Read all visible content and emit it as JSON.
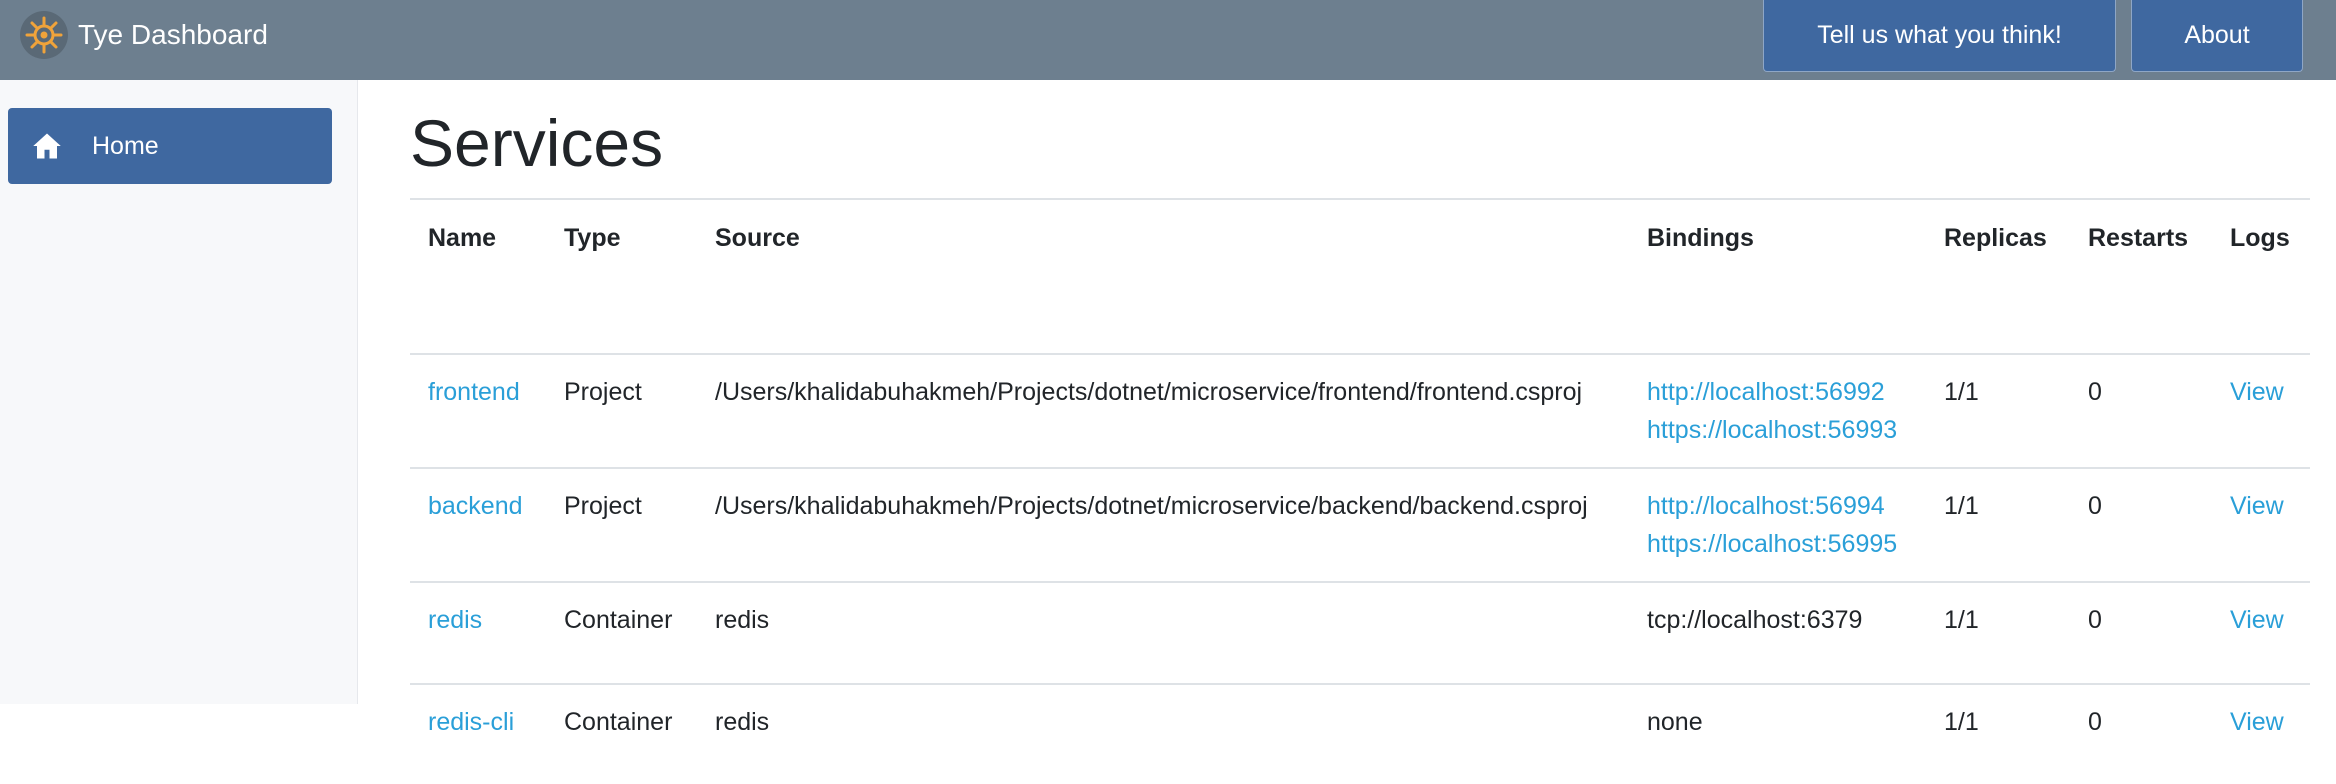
{
  "header": {
    "title": "Tye Dashboard",
    "feedback_label": "Tell us what you think!",
    "about_label": "About",
    "logo_icon": "ship-wheel-icon"
  },
  "sidebar": {
    "items": [
      {
        "label": "Home",
        "icon": "home-icon"
      }
    ]
  },
  "main": {
    "title": "Services",
    "columns": [
      "Name",
      "Type",
      "Source",
      "Bindings",
      "Replicas",
      "Restarts",
      "Logs"
    ],
    "rows": [
      {
        "name": "frontend",
        "type": "Project",
        "source": "/Users/khalidabuhakmeh/Projects/dotnet/microservice/frontend/frontend.csproj",
        "bindings": [
          "http://localhost:56992",
          "https://localhost:56993"
        ],
        "replicas": "1/1",
        "restarts": "0",
        "logs": "View"
      },
      {
        "name": "backend",
        "type": "Project",
        "source": "/Users/khalidabuhakmeh/Projects/dotnet/microservice/backend/backend.csproj",
        "bindings": [
          "http://localhost:56994",
          "https://localhost:56995"
        ],
        "replicas": "1/1",
        "restarts": "0",
        "logs": "View"
      },
      {
        "name": "redis",
        "type": "Container",
        "source": "redis",
        "bindings": [
          "tcp://localhost:6379"
        ],
        "replicas": "1/1",
        "restarts": "0",
        "logs": "View"
      },
      {
        "name": "redis-cli",
        "type": "Container",
        "source": "redis",
        "bindings": [
          "none"
        ],
        "replicas": "1/1",
        "restarts": "0",
        "logs": "View"
      }
    ]
  },
  "colors": {
    "topbar": "#6d7f8f",
    "primary": "#3f68a0",
    "link": "#2a9fd8"
  }
}
